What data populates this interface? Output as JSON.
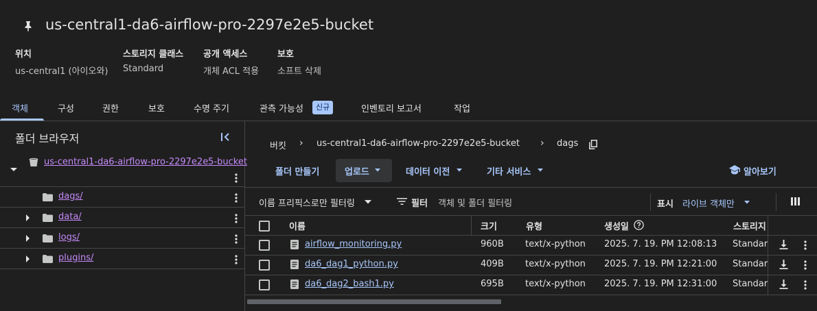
{
  "bucket": {
    "title": "us-central1-da6-airflow-pro-2297e2e5-bucket"
  },
  "meta": [
    {
      "key": "위치",
      "value": "us-central1 (아이오와)"
    },
    {
      "key": "스토리지 클래스",
      "value": "Standard"
    },
    {
      "key": "공개 액세스",
      "value": "개체 ACL 적용"
    },
    {
      "key": "보호",
      "value": "소프트 삭제"
    }
  ],
  "tabs": [
    {
      "label": "객체",
      "active": true
    },
    {
      "label": "구성"
    },
    {
      "label": "권한"
    },
    {
      "label": "보호"
    },
    {
      "label": "수명 주기"
    },
    {
      "label": "관측 가능성"
    },
    {
      "label": "인벤토리 보고서"
    },
    {
      "label": "작업"
    }
  ],
  "new_badge": "신규",
  "folder_browser": {
    "title": "폴더 브라우저",
    "root": "us-central1-da6-airflow-pro-2297e2e5-bucket",
    "folders": [
      "dags/",
      "data/",
      "logs/",
      "plugins/"
    ]
  },
  "breadcrumb": {
    "root": "버킷",
    "bucket": "us-central1-da6-airflow-pro-2297e2e5-bucket",
    "current": "dags"
  },
  "actions": {
    "create_folder": "폴더 만들기",
    "upload": "업로드",
    "transfer": "데이터 이전",
    "other": "기타 서비스",
    "learn": "알아보기"
  },
  "filter": {
    "prefix_filter": "이름 프리픽스로만 필터링",
    "filter_label": "필터",
    "filter_placeholder": "객체 및 폴더 필터링",
    "show_label": "표시",
    "show_value": "라이브 객체만"
  },
  "table": {
    "headers": {
      "name": "이름",
      "size": "크기",
      "type": "유형",
      "created": "생성일",
      "storage": "스토리지"
    },
    "rows": [
      {
        "name": "airflow_monitoring.py",
        "size": "960B",
        "type": "text/x-python",
        "created": "2025. 7. 19. PM 12:08:13",
        "storage": "Standard"
      },
      {
        "name": "da6_dag1_python.py",
        "size": "409B",
        "type": "text/x-python",
        "created": "2025. 7. 19. PM 12:21:00",
        "storage": "Standard"
      },
      {
        "name": "da6_dag2_bash1.py",
        "size": "695B",
        "type": "text/x-python",
        "created": "2025. 7. 19. PM 12:31:00",
        "storage": "Standard"
      }
    ]
  },
  "colors": {
    "accent": "#a8c7fa",
    "visited": "#c58af9",
    "background": "#1f1f1f",
    "border": "#444746"
  }
}
